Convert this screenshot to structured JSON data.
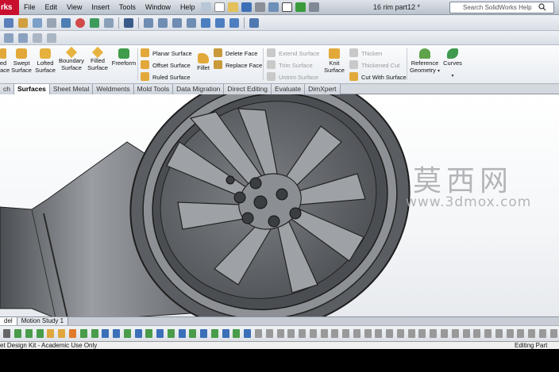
{
  "titlebar": {
    "app_label": "rks",
    "menus": [
      "File",
      "Edit",
      "View",
      "Insert",
      "Tools",
      "Window",
      "Help"
    ],
    "document_title": "16 rim part12 *",
    "help_search_placeholder": "Search SolidWorks Help"
  },
  "command_manager": {
    "big_buttons": [
      {
        "label": "ed\nface",
        "name": "extruded-surface-button"
      },
      {
        "label": "Swept\nSurface",
        "name": "swept-surface-button"
      },
      {
        "label": "Lofted\nSurface",
        "name": "lofted-surface-button"
      },
      {
        "label": "Boundary\nSurface",
        "name": "boundary-surface-button"
      },
      {
        "label": "Filled\nSurface",
        "name": "filled-surface-button"
      },
      {
        "label": "Freeform",
        "name": "freeform-button"
      }
    ],
    "col1": [
      "Planar Surface",
      "Offset Surface",
      "Ruled Surface"
    ],
    "fillet_label": "Fillet",
    "col2": [
      "Delete Face",
      "Replace Face"
    ],
    "col3": [
      "Extend Surface",
      "Trim Surface",
      "Untrim Surface"
    ],
    "knit_label": "Knit\nSurface",
    "col4": [
      "Thicken",
      "Thickened Cut",
      "Cut With Surface"
    ],
    "ref_geometry_label": "Reference\nGeometry",
    "curves_label": "Curves"
  },
  "tabs": [
    {
      "label": "ch",
      "active": false
    },
    {
      "label": "Surfaces",
      "active": true
    },
    {
      "label": "Sheet Metal",
      "active": false
    },
    {
      "label": "Weldments",
      "active": false
    },
    {
      "label": "Mold Tools",
      "active": false
    },
    {
      "label": "Data Migration",
      "active": false
    },
    {
      "label": "Direct Editing",
      "active": false
    },
    {
      "label": "Evaluate",
      "active": false
    },
    {
      "label": "DimXpert",
      "active": false
    }
  ],
  "watermark": {
    "cn": "莫西网",
    "url": "www.3dmox.com"
  },
  "model_tabs": [
    {
      "label": "del",
      "active": true
    },
    {
      "label": "Motion Study 1",
      "active": false
    }
  ],
  "status": {
    "left": "et Design Kit - Academic Use Only",
    "right": "Editing Part"
  },
  "colors": {
    "accent": "#c8102e",
    "rim": "#6b6e72",
    "viewport_top": "#ffffff"
  }
}
